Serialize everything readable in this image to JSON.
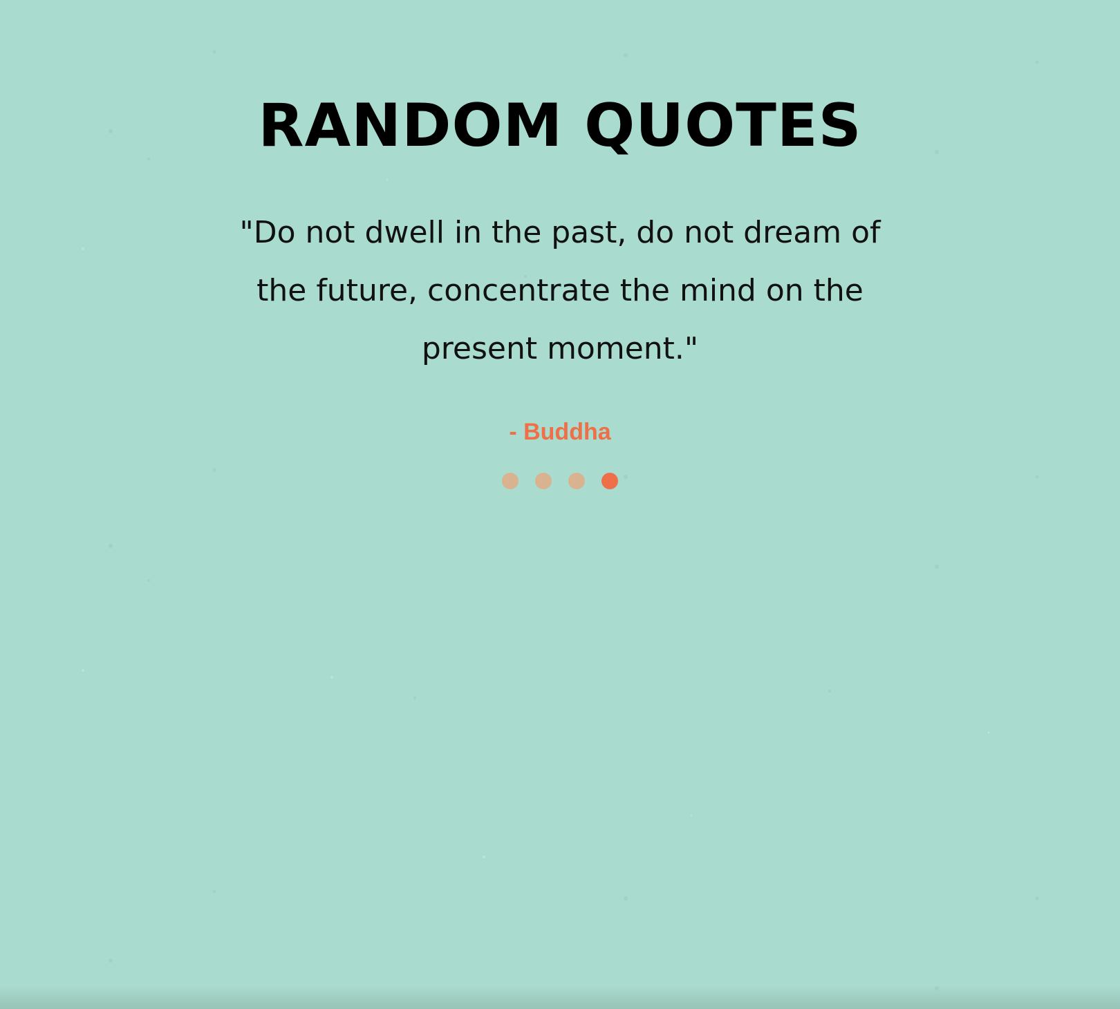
{
  "page": {
    "title": "RANDOM QUOTES",
    "background_color": "#a9dbce"
  },
  "quote": {
    "text": "\"Do not dwell in the past, do not dream of the future, concentrate the mind on the present moment.\"",
    "author": "- Buddha",
    "author_color": "#ee6f48"
  },
  "pagination": {
    "count": 4,
    "active_index": 3,
    "active_color": "#ee6f48",
    "inactive_color": "#d9b38f"
  }
}
